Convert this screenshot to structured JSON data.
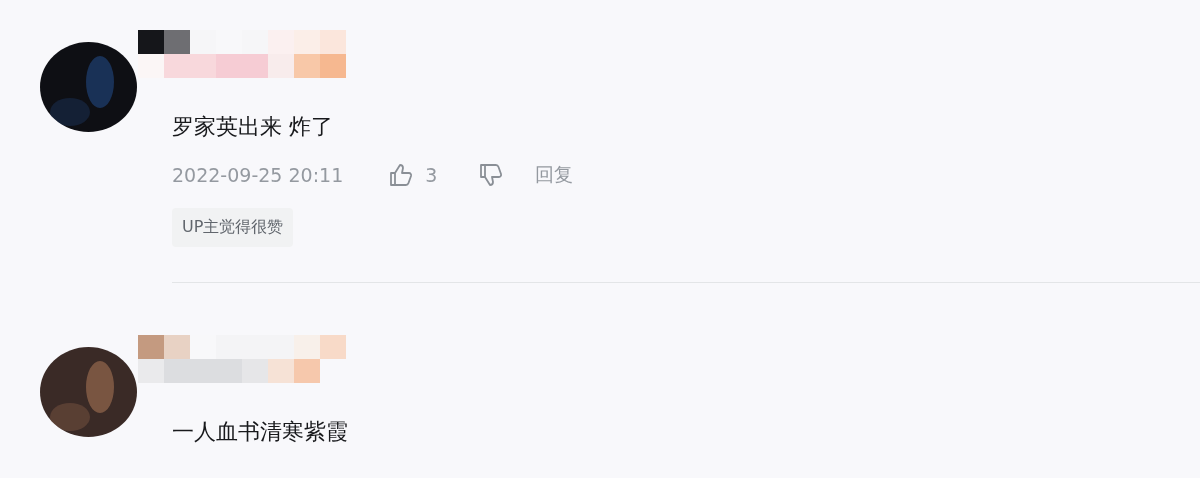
{
  "comments": [
    {
      "text": "罗家英出来 炸了",
      "time": "2022-09-25 20:11",
      "likes": "3",
      "reply": "回复",
      "badge": "UP主觉得很赞"
    },
    {
      "text": "一人血书清寒紫霞"
    }
  ]
}
